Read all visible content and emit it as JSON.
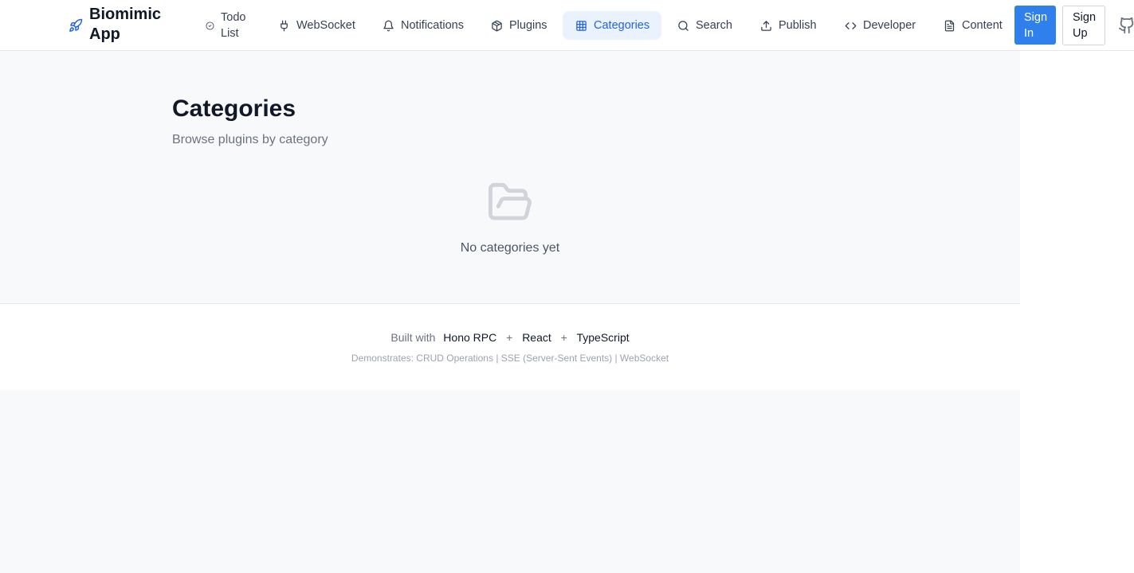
{
  "header": {
    "brand": "Biomimic App",
    "nav": [
      {
        "label": "Todo List",
        "icon": "check-circle-icon"
      },
      {
        "label": "WebSocket",
        "icon": "plug-icon"
      },
      {
        "label": "Notifications",
        "icon": "bell-icon"
      },
      {
        "label": "Plugins",
        "icon": "package-icon"
      },
      {
        "label": "Categories",
        "icon": "grid-icon",
        "active": true
      },
      {
        "label": "Search",
        "icon": "search-icon"
      },
      {
        "label": "Publish",
        "icon": "upload-icon"
      },
      {
        "label": "Developer",
        "icon": "code-icon"
      },
      {
        "label": "Content",
        "icon": "file-text-icon"
      }
    ],
    "sign_in": "Sign In",
    "sign_up": "Sign Up",
    "github_icon": "github-icon"
  },
  "main": {
    "title": "Categories",
    "subtitle": "Browse plugins by category",
    "empty_icon": "folder-open-icon",
    "empty_text": "No categories yet"
  },
  "footer": {
    "built_with": "Built with",
    "tech": [
      "Hono RPC",
      "React",
      "TypeScript"
    ],
    "separator": "+",
    "demonstrates": "Demonstrates: CRUD Operations | SSE (Server-Sent Events) | WebSocket"
  },
  "colors": {
    "accent": "#2f80ed",
    "active_nav_bg": "#eaf2fd",
    "active_nav_text": "#2563eb",
    "page_bg": "#f8f9fb"
  }
}
